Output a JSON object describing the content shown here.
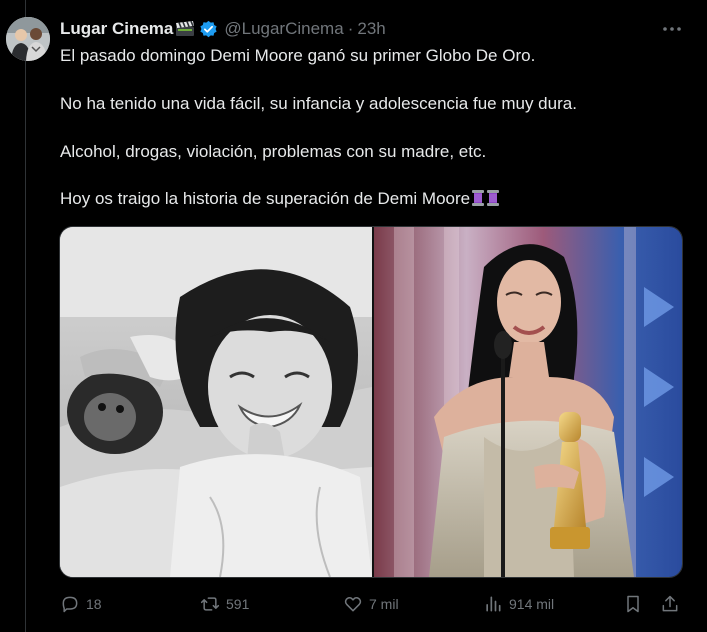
{
  "author": {
    "name": "Lugar Cinema",
    "name_emoji": "clapper-board-emoji",
    "verified": true,
    "handle": "@LugarCinema",
    "separator": "·",
    "time": "23h"
  },
  "tweet": {
    "paragraphs": [
      "El pasado domingo Demi Moore ganó su primer Globo De Oro.",
      "No ha tenido una vida fácil, su infancia y adolescencia fue muy dura.",
      "Alcohol, drogas, violación, problemas con su madre, etc.",
      "Hoy os traigo la historia de superación de Demi Moore"
    ],
    "trailing_emoji": [
      "thread-spool-emoji",
      "thread-spool-emoji"
    ]
  },
  "media": {
    "left": "black-and-white childhood photo of a smiling girl with a chimpanzee",
    "right": "woman in metallic gown holding a golden trophy at a microphone on stage"
  },
  "actions": {
    "replies": "18",
    "reposts": "591",
    "likes": "7 mil",
    "views": "914 mil"
  },
  "colors": {
    "background": "#000000",
    "text": "#e7e9ea",
    "muted": "#71767b",
    "verified": "#1d9bf0",
    "border": "#2f3336"
  }
}
